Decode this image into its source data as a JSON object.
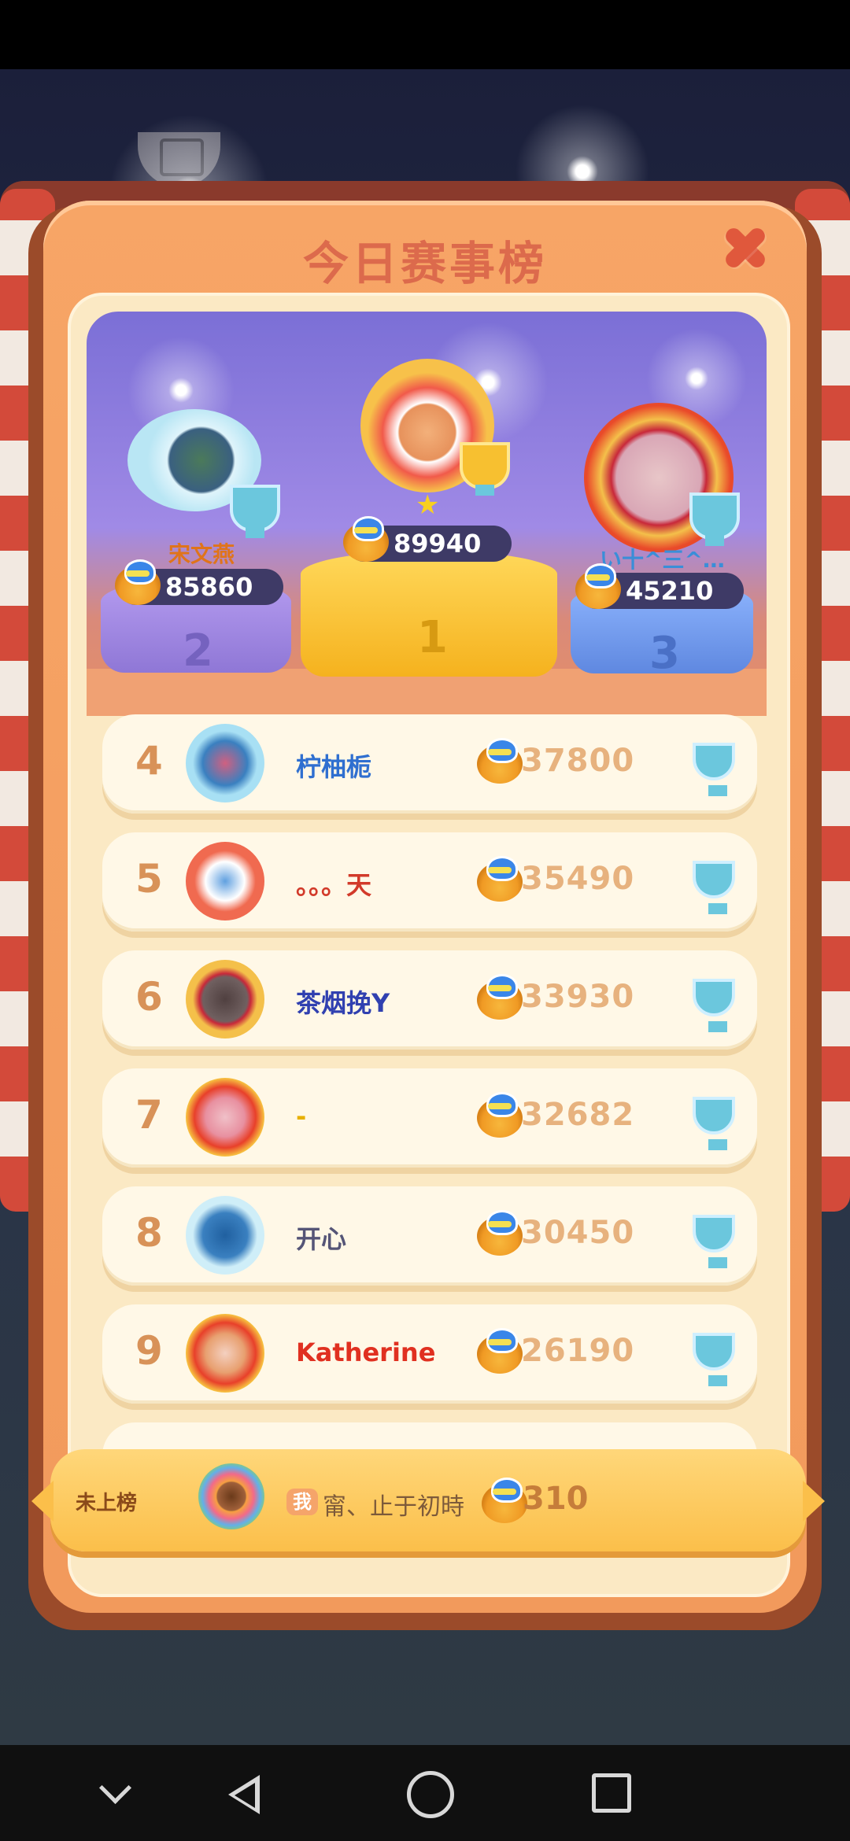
{
  "header": {
    "title": "今日赛事榜"
  },
  "podium": {
    "first": {
      "rank": "1",
      "score": "89940"
    },
    "second": {
      "rank": "2",
      "name": "宋文燕",
      "score": "85860"
    },
    "third": {
      "rank": "3",
      "name": "い十^三^…",
      "score": "45210"
    }
  },
  "rows": [
    {
      "rank": "4",
      "name": "柠柚栀",
      "score": "37800",
      "name_color": "#2f6fd0"
    },
    {
      "rank": "5",
      "name": "。。。天",
      "score": "35490",
      "name_color": "#d23a2a"
    },
    {
      "rank": "6",
      "name": "茶烟挽Y",
      "score": "33930",
      "name_color": "#3040b0"
    },
    {
      "rank": "7",
      "name": "-",
      "score": "32682",
      "name_color": "#e7b000"
    },
    {
      "rank": "8",
      "name": "开心",
      "score": "30450",
      "name_color": "#555577"
    },
    {
      "rank": "9",
      "name": "Katherine",
      "score": "26190",
      "name_color": "#e03020"
    }
  ],
  "me": {
    "status": "未上榜",
    "badge": "我",
    "name": "甯、止于初時",
    "score": "310"
  },
  "colors": {
    "accent": "#f29a5c",
    "title": "#dc6a4c",
    "row_bg": "#fff8e7",
    "score": "#e7b27e"
  },
  "icons": [
    "close-icon",
    "trophy-icon",
    "coin-icon",
    "star-icon",
    "back-icon",
    "home-icon",
    "recents-icon",
    "collapse-icon"
  ]
}
